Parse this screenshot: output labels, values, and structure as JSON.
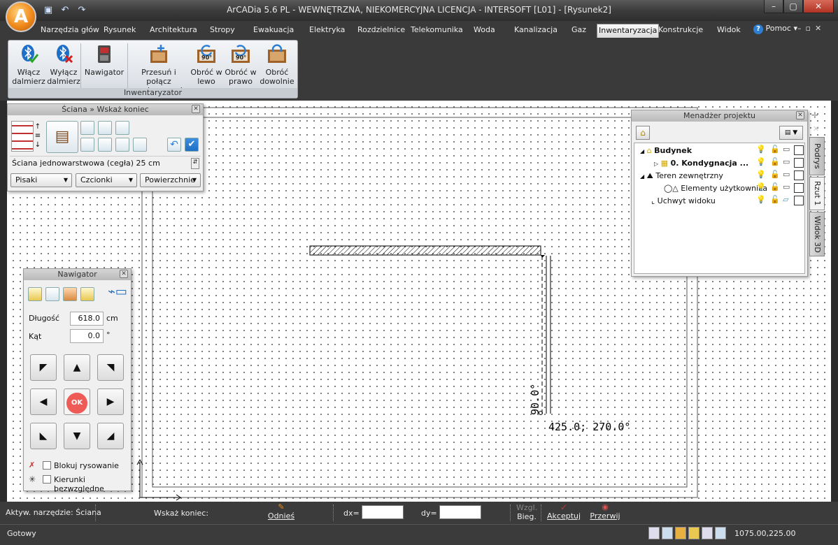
{
  "app": {
    "title": "ArCADia 5.6 PL - WEWNĘTRZNA, NIEKOMERCYJNA LICENCJA - INTERSOFT [L01] - [Rysunek2]",
    "logo_letter": "A"
  },
  "ribbon": {
    "tabs": [
      {
        "label": "Narzędzia głów"
      },
      {
        "label": "Rysunek"
      },
      {
        "label": "Architektura"
      },
      {
        "label": "Stropy"
      },
      {
        "label": "Ewakuacja"
      },
      {
        "label": "Elektryka"
      },
      {
        "label": "Rozdzielnice"
      },
      {
        "label": "Telekomunika"
      },
      {
        "label": "Woda"
      },
      {
        "label": "Kanalizacja"
      },
      {
        "label": "Gaz"
      },
      {
        "label": "Inwentaryzacja"
      },
      {
        "label": "Konstrukcje"
      },
      {
        "label": "Widok"
      }
    ],
    "active_tab": "Inwentaryzacja",
    "help_label": "Pomoc",
    "group_label": "Inwentaryzator",
    "buttons": {
      "enable_rangefinder": "Włącz dalmierz",
      "disable_rangefinder": "Wyłącz dalmierz",
      "navigator": "Nawigator",
      "move_join": "Przesuń i połącz pomieszczenia",
      "rotate_left": "Obróć w lewo",
      "rotate_right": "Obróć w prawo",
      "rotate_any": "Obróć dowolnie"
    },
    "rotate_badge": "90°"
  },
  "wall_panel": {
    "title": "Ściana » Wskaż koniec",
    "wall_type": "Ściana jednowarstwowa (cegła) 25 cm",
    "dropdowns": [
      "Pisaki",
      "Czcionki",
      "Powierzchnie"
    ]
  },
  "project_manager": {
    "title": "Menadżer projektu",
    "tree": [
      {
        "label": "Budynek",
        "bold": true
      },
      {
        "label": "0. Kondygnacja ...",
        "bold": true
      },
      {
        "label": "Teren zewnętrzny",
        "bold": false
      },
      {
        "label": "Elementy użytkownika",
        "bold": false
      },
      {
        "label": "Uchwyt widoku",
        "bold": false
      }
    ]
  },
  "side_tabs": [
    "Podrys",
    "Rzut 1",
    "Widok 3D"
  ],
  "navigator": {
    "title": "Nawigator",
    "length_label": "Długość",
    "length_value": "618.0",
    "length_unit": "cm",
    "angle_label": "Kąt",
    "angle_value": "0.0",
    "angle_unit": "°",
    "ok_label": "OK",
    "lock_drawing": "Blokuj rysowanie",
    "absolute_directions": "Kierunki bezwzględne"
  },
  "drawing": {
    "angle_annotation": "90.0°",
    "coord_annotation": "425.0; 270.0°"
  },
  "command_bar": {
    "active_tool": "Aktyw. narzędzie: Ściana",
    "prompt": "Wskaż koniec:",
    "reference": "Odnieś",
    "dx_label": "dx=",
    "dy_label": "dy=",
    "relative_top": "Wzgl.",
    "relative_bottom": "Bieg.",
    "accept": "Akceptuj",
    "interrupt": "Przerwij"
  },
  "status": {
    "text": "Gotowy",
    "coordinates": "1075.00,225.00"
  }
}
